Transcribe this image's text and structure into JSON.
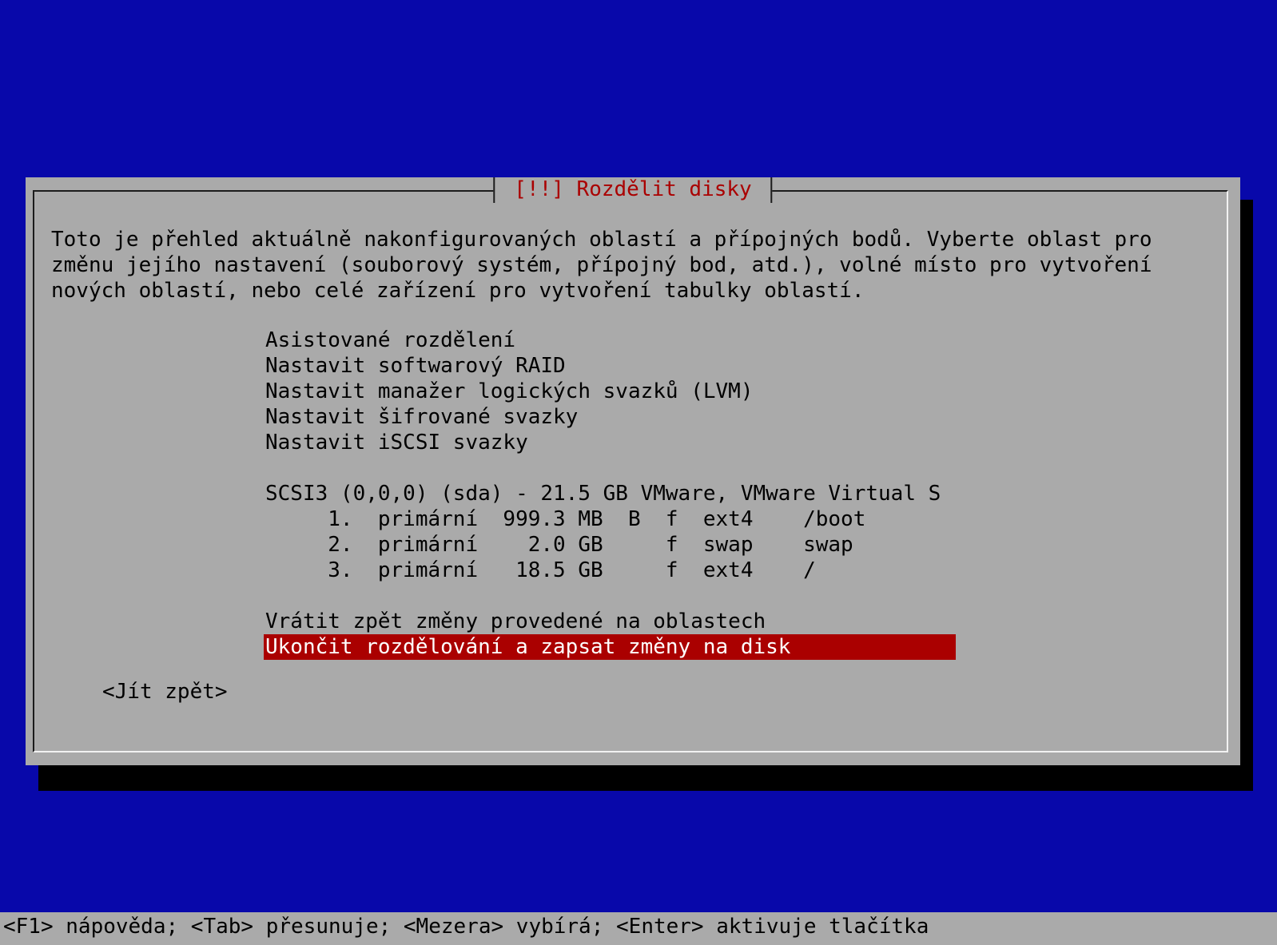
{
  "dialog": {
    "title": "[!!] Rozdělit disky",
    "description": "Toto je přehled aktuálně nakonfigurovaných oblastí a přípojných bodů. Vyberte oblast pro\nzměnu jejího nastavení (souborový systém, přípojný bod, atd.), volné místo pro vytvoření\nnových oblastí, nebo celé zařízení pro vytvoření tabulky oblastí.",
    "menu": [
      "Asistované rozdělení",
      "Nastavit softwarový RAID",
      "Nastavit manažer logických svazků (LVM)",
      "Nastavit šifrované svazky",
      "Nastavit iSCSI svazky",
      "",
      "SCSI3 (0,0,0) (sda) - 21.5 GB VMware, VMware Virtual S",
      "     1.  primární  999.3 MB  B  f  ext4    /boot",
      "     2.  primární    2.0 GB     f  swap    swap",
      "     3.  primární   18.5 GB     f  ext4    /",
      "",
      "Vrátit zpět změny provedené na oblastech",
      "Ukončit rozdělování a zapsat změny na disk"
    ],
    "selected_index": 12,
    "back_button": "<Jít zpět>"
  },
  "helpbar": "<F1> nápověda; <Tab> přesunuje; <Mezera> vybírá; <Enter> aktivuje tlačítka",
  "colors": {
    "background": "#0808aa",
    "dialog": "#aaaaaa",
    "title": "#aa0000",
    "selected_bg": "#aa0000",
    "selected_fg": "#ffffff"
  }
}
